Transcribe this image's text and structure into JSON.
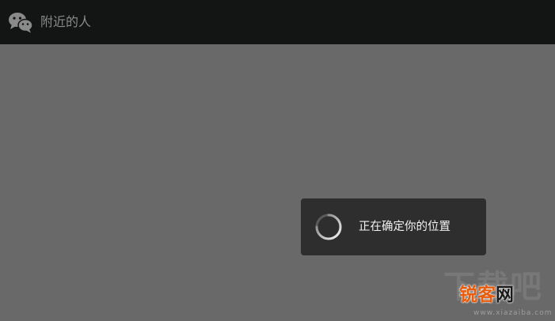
{
  "titlebar": {
    "icon": "wechat-icon",
    "title": "附近的人"
  },
  "toast": {
    "spinner_icon": "loading-spinner-icon",
    "message": "正在确定你的位置"
  },
  "watermark": {
    "back_text": "下载吧",
    "brand_red": "锐客",
    "brand_black": "网",
    "url": "www.xiazaiba.com"
  },
  "colors": {
    "titlebar_bg": "#131414",
    "content_bg": "#696969",
    "toast_bg": "#2e2e2e",
    "title_text": "#8a8a8a",
    "toast_text": "#f2f2f2",
    "watermark_accent": "#e85c0e"
  }
}
